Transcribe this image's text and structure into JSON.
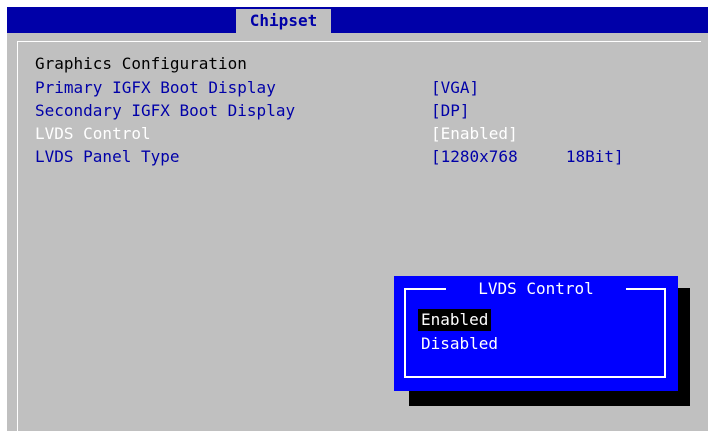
{
  "tab": {
    "label": "Chipset"
  },
  "section": {
    "title": "Graphics Configuration"
  },
  "settings": [
    {
      "label": "Primary IGFX Boot Display",
      "value": "[VGA]"
    },
    {
      "label": "Secondary IGFX Boot Display",
      "value": "[DP]"
    },
    {
      "label": "LVDS Control",
      "value": "[Enabled]"
    },
    {
      "label": "LVDS Panel Type",
      "value": "[1280x768     18Bit]"
    }
  ],
  "popup": {
    "title": "LVDS Control",
    "options": [
      {
        "label": "Enabled",
        "selected": true
      },
      {
        "label": "Disabled",
        "selected": false
      }
    ]
  },
  "colors": {
    "bar": "#0000a8",
    "panel": "#c0c0c0",
    "popup": "#0000ff",
    "text_blue": "#0000a8",
    "text_white": "#ffffff"
  }
}
